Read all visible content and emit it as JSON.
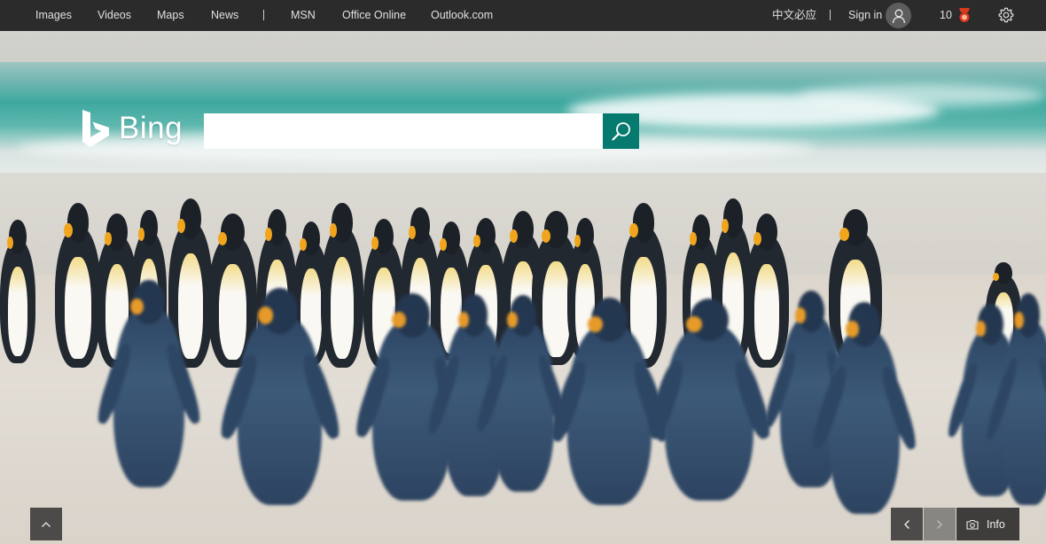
{
  "topbar": {
    "nav": [
      "Images",
      "Videos",
      "Maps",
      "News"
    ],
    "more": [
      "MSN",
      "Office Online",
      "Outlook.com"
    ],
    "lang": "中文必应",
    "sign_in": "Sign in",
    "rewards_count": "10"
  },
  "logo": {
    "text": "Bing"
  },
  "search": {
    "value": "",
    "placeholder": ""
  },
  "info": {
    "label": "Info"
  },
  "colors": {
    "topbar": "#2b2b2b",
    "accent": "#067a6e",
    "reward": "#d9391d"
  },
  "icons": [
    "bing-logo-icon",
    "search-icon",
    "user-icon",
    "rewards-medal-icon",
    "gear-icon",
    "chevron-up-icon",
    "chevron-left-icon",
    "chevron-right-icon",
    "camera-icon"
  ]
}
